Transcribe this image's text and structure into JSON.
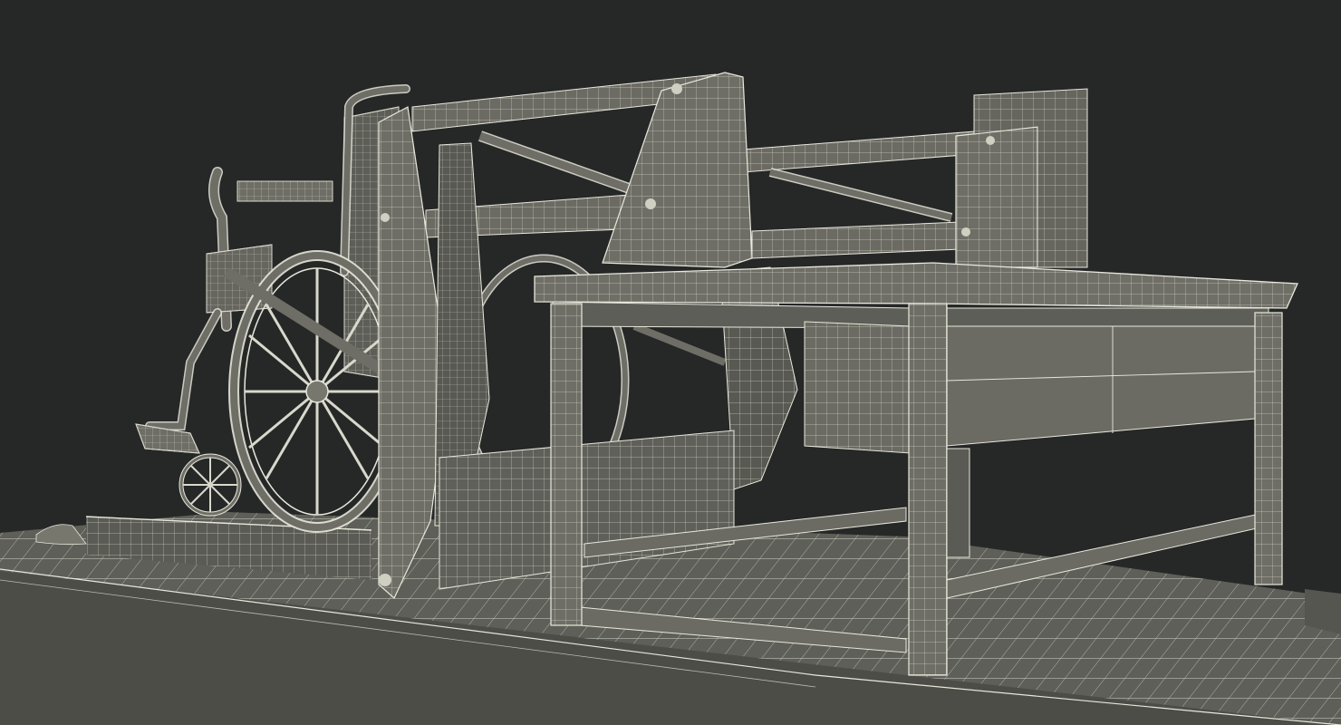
{
  "colors": {
    "background": "#262828",
    "surface": "#6b6b63",
    "surface_dark": "#4e4f4a",
    "surface_light": "#85857b",
    "wire": "#e8e8dc"
  },
  "scene": {
    "objects": [
      "platform-base",
      "wheelchair",
      "lift-frame",
      "deck-table"
    ]
  }
}
